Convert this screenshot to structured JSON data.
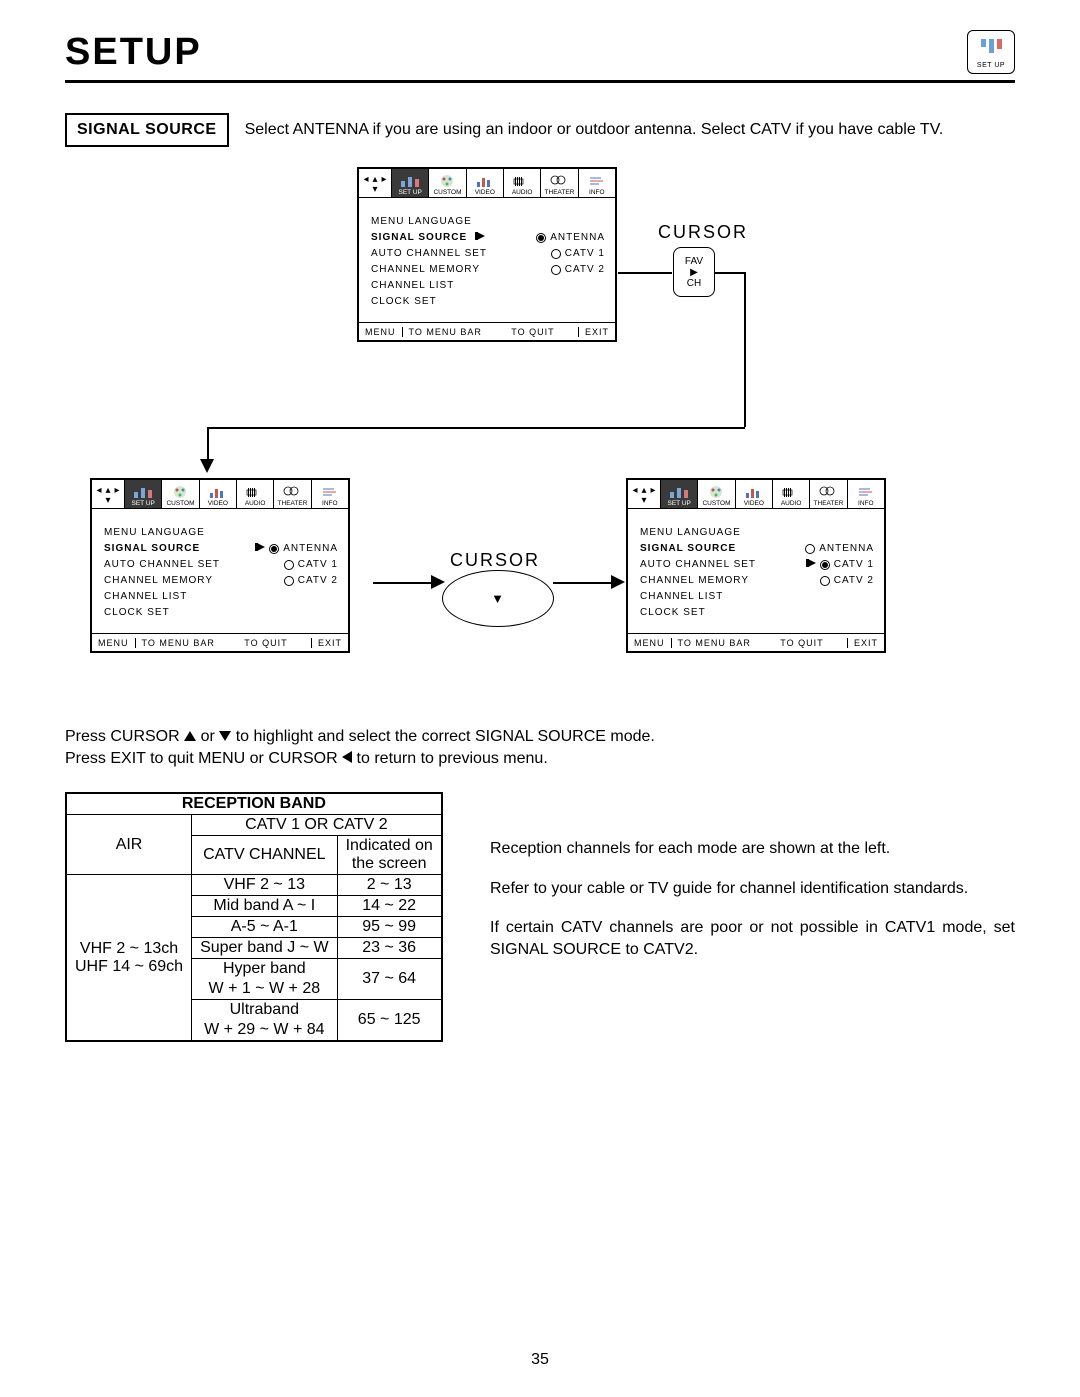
{
  "header": {
    "title": "SETUP",
    "icon_caption": "SET UP"
  },
  "signal_source": {
    "label": "SIGNAL SOURCE",
    "description": "Select ANTENNA if you are using an indoor or outdoor antenna.  Select CATV if you have cable TV."
  },
  "cursor_label_top": "CURSOR",
  "cursor_label_mid": "CURSOR",
  "remote_sq": {
    "l1": "FAV",
    "l2": "▶",
    "l3": "CH"
  },
  "remote_mid_sym": "▼",
  "tv_tabs": [
    "SET UP",
    "CUSTOM",
    "VIDEO",
    "AUDIO",
    "THEATER",
    "INFO"
  ],
  "menu_items": {
    "menu_language": "MENU LANGUAGE",
    "signal_source": "SIGNAL SOURCE",
    "auto_channel_set": "AUTO CHANNEL SET",
    "channel_memory": "CHANNEL MEMORY",
    "channel_list": "CHANNEL LIST",
    "clock_set": "CLOCK SET"
  },
  "options": {
    "antenna": "ANTENNA",
    "catv1": "CATV 1",
    "catv2": "CATV 2"
  },
  "footer": {
    "menu": "MENU",
    "tomenu": "TO MENU BAR",
    "toquit": "TO QUIT",
    "exit": "EXIT"
  },
  "instructions": {
    "l1a": "Press CURSOR ",
    "l1b": " or ",
    "l1c": " to highlight and select the correct SIGNAL SOURCE mode.",
    "l2a": "Press EXIT to quit MENU or CURSOR ",
    "l2b": " to return to previous menu."
  },
  "table": {
    "title": "RECEPTION BAND",
    "catv_hdr": "CATV 1 OR CATV 2",
    "air": "AIR",
    "catv_channel": "CATV CHANNEL",
    "indicated": "Indicated on",
    "screen": "the screen",
    "air_rows": {
      "r1": "VHF 2 ~ 13ch",
      "r2": "UHF 14 ~ 69ch"
    },
    "rows": [
      {
        "c": "VHF 2 ~ 13",
        "s": "2 ~ 13"
      },
      {
        "c": "Mid band A ~ I",
        "s": "14 ~ 22"
      },
      {
        "c": "A-5 ~ A-1",
        "s": "95 ~ 99"
      },
      {
        "c": "Super band J ~ W",
        "s": "23 ~ 36"
      },
      {
        "c": "Hyper band",
        "s": "37 ~ 64"
      },
      {
        "c": "W + 1 ~ W + 28",
        "s": ""
      },
      {
        "c": "Ultraband",
        "s": "65 ~ 125"
      },
      {
        "c": "W + 29 ~ W + 84",
        "s": ""
      }
    ]
  },
  "side_text": {
    "p1": "Reception channels for each mode are shown at the left.",
    "p2": "Refer to your cable or TV guide for channel identification standards.",
    "p3": "If certain CATV channels are poor or not possible in CATV1 mode, set SIGNAL SOURCE to CATV2."
  },
  "page_number": "35"
}
